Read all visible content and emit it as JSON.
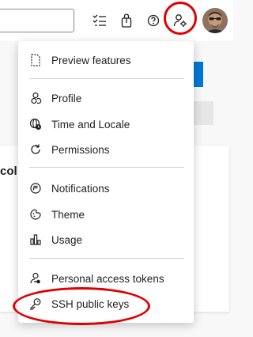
{
  "menu": {
    "items": [
      {
        "label": "Preview features",
        "icon": "document-icon"
      },
      {
        "label": "Profile",
        "icon": "profile-icon"
      },
      {
        "label": "Time and Locale",
        "icon": "globe-clock-icon"
      },
      {
        "label": "Permissions",
        "icon": "refresh-icon"
      },
      {
        "label": "Notifications",
        "icon": "notification-icon"
      },
      {
        "label": "Theme",
        "icon": "theme-icon"
      },
      {
        "label": "Usage",
        "icon": "usage-chart-icon"
      },
      {
        "label": "Personal access tokens",
        "icon": "token-icon"
      },
      {
        "label": "SSH public keys",
        "icon": "key-icon"
      }
    ]
  },
  "background": {
    "card_text": "col"
  },
  "colors": {
    "highlight": "#e00000",
    "accent": "#0078d4"
  }
}
